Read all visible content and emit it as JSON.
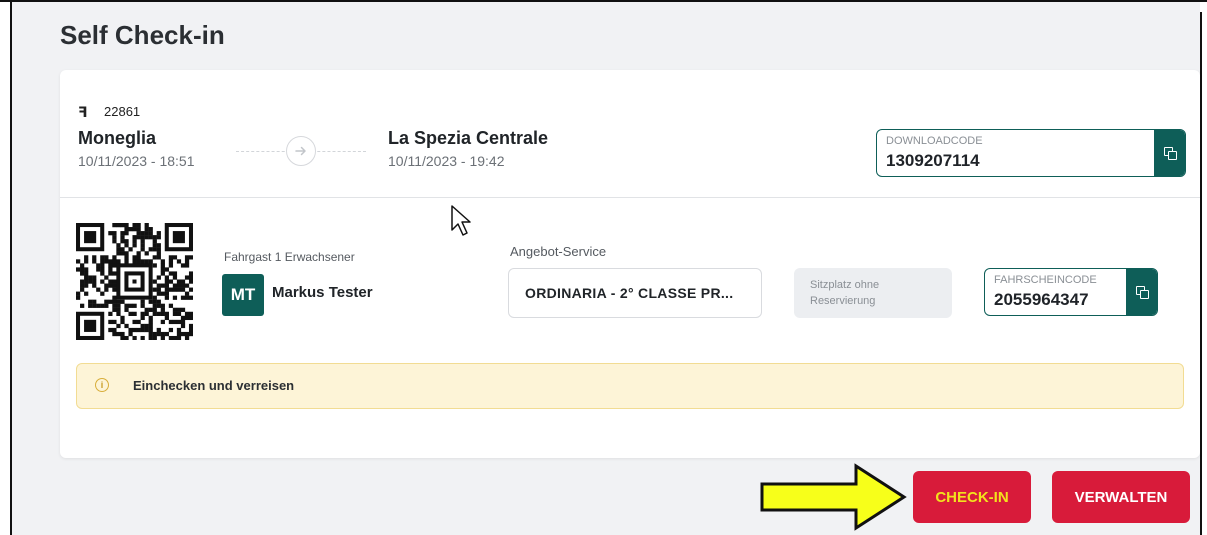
{
  "page": {
    "title": "Self Check-in"
  },
  "journey": {
    "train_icon": "ꟻ",
    "train_number": "22861",
    "from": {
      "station": "Moneglia",
      "datetime": "10/11/2023 - 18:51"
    },
    "to": {
      "station": "La Spezia Centrale",
      "datetime": "10/11/2023 - 19:42"
    },
    "route_icon": "arrow-right-circle-icon"
  },
  "download_code": {
    "label": "DOWNLOADCODE",
    "value": "1309207114",
    "copy_icon": "copy-icon"
  },
  "passenger": {
    "label": "Fahrgast 1 Erwachsener",
    "initials": "MT",
    "name": "Markus Tester"
  },
  "offer": {
    "label": "Angebot-Service",
    "value": "ORDINARIA - 2° CLASSE PR..."
  },
  "seat": {
    "line1": "Sitzplatz ohne",
    "line2": "Reservierung"
  },
  "ticket_code": {
    "label": "FAHRSCHEINCODE",
    "value": "2055964347",
    "copy_icon": "copy-icon"
  },
  "notice": {
    "icon": "info-icon",
    "icon_glyph": "i",
    "text": "Einchecken und verreisen"
  },
  "actions": {
    "checkin_label": "CHECK-IN",
    "manage_label": "VERWALTEN"
  },
  "colors": {
    "brand_teal": "#0e5e58",
    "button_red": "#d81b3a",
    "checkin_text_highlight": "#f2e21d",
    "annotation_arrow": "#f7ff1a",
    "notice_bg": "#fdf4d7"
  }
}
